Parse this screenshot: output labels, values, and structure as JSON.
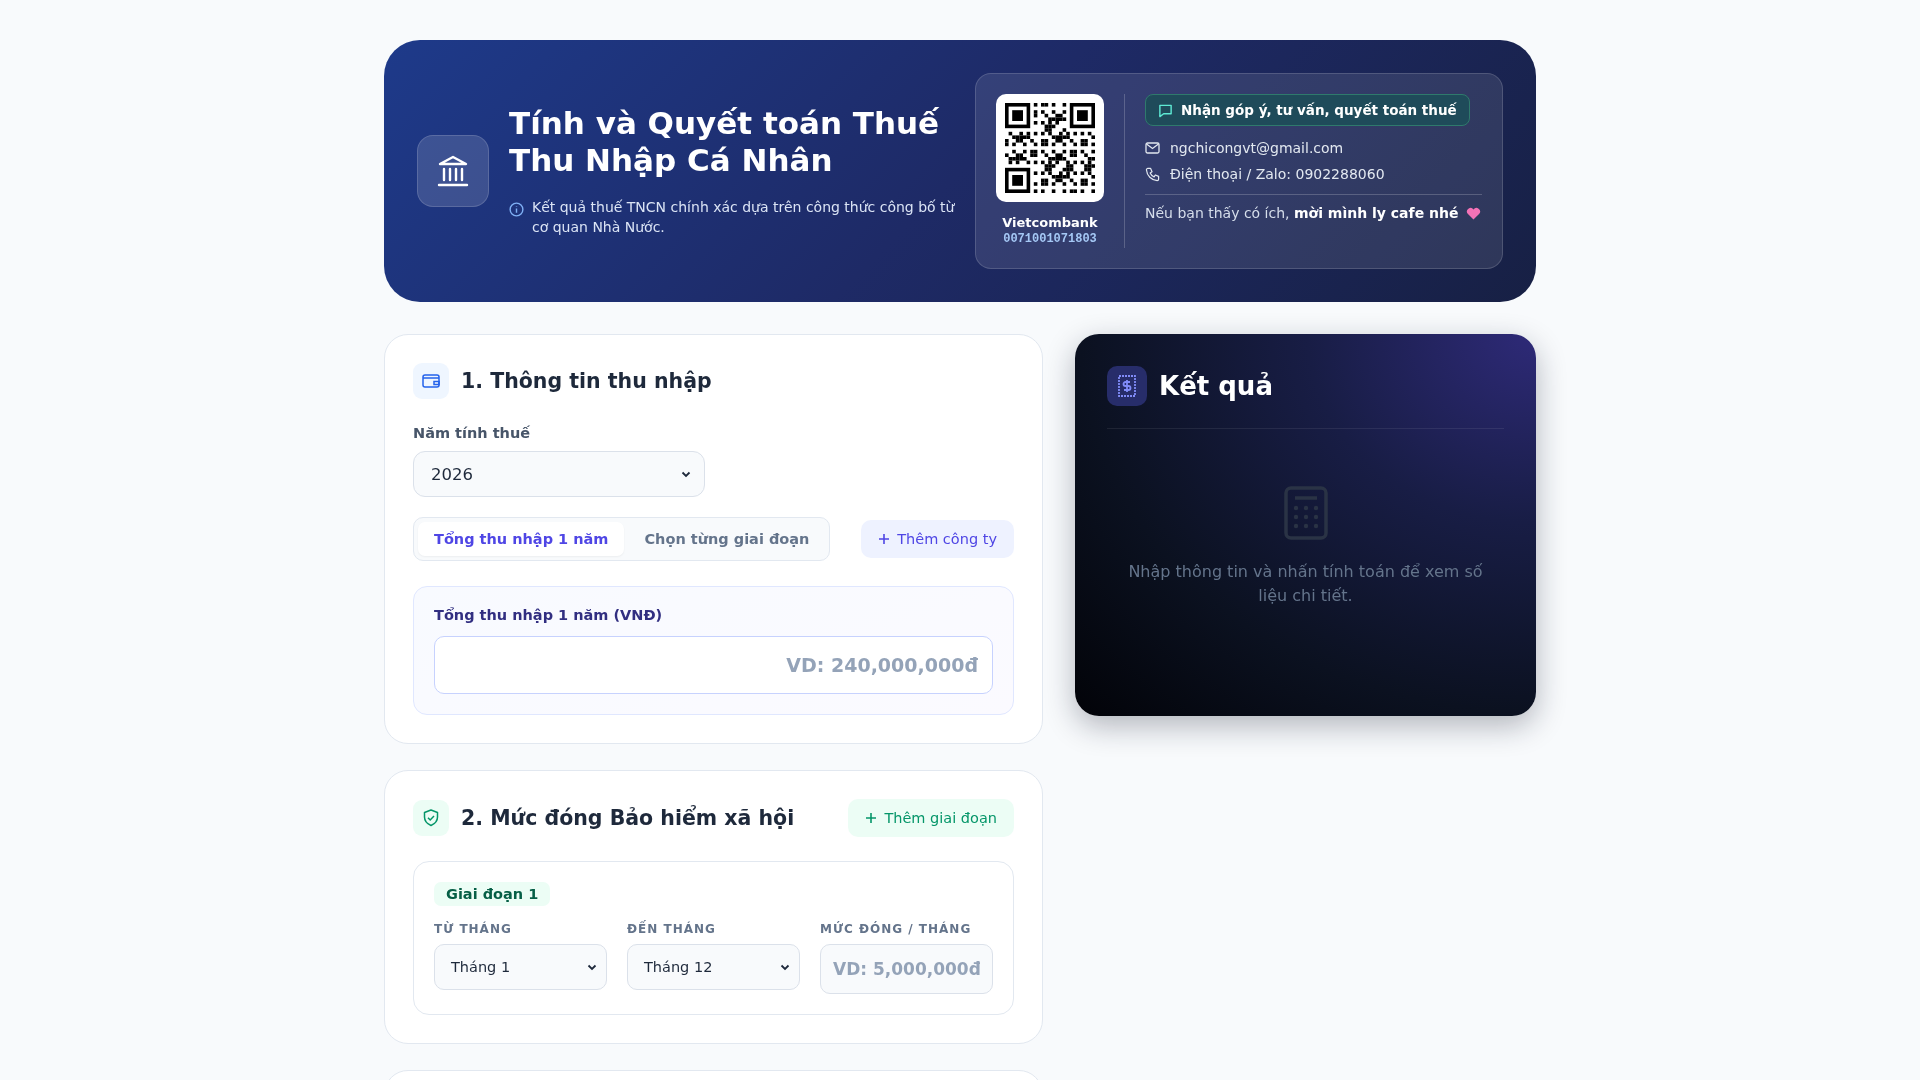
{
  "header": {
    "title_line1": "Tính và Quyết toán Thuế",
    "title_line2": "Thu Nhập Cá Nhân",
    "subtitle": "Kết quả thuế TNCN chính xác dựa trên công thức công bố từ cơ quan Nhà Nước.",
    "donate": {
      "bank": "Vietcombank",
      "account": "0071001071803",
      "feedback_button": "Nhận góp ý, tư vấn, quyết toán thuế",
      "email": "ngchicongvt@gmail.com",
      "phone": "Điện thoại / Zalo: 0902288060",
      "note": "Nếu bạn thấy có ích, **mời mình ly cafe nhé**"
    }
  },
  "income": {
    "title": "1. Thông tin thu nhập",
    "year_label": "Năm tính thuế",
    "year_value": "2026",
    "modes": [
      {
        "label": "Tổng thu nhập 1 năm",
        "selected": true
      },
      {
        "label": "Chọn từng giai đoạn",
        "selected": false
      }
    ],
    "add_company": "Thêm công ty",
    "total_label": "Tổng thu nhập 1 năm (VNĐ)",
    "total_placeholder": "VD: 240,000,000đ"
  },
  "insurance": {
    "title": "2. Mức đóng Bảo hiểm xã hội",
    "add_period": "Thêm giai đoạn",
    "periods": [
      {
        "badge": "Giai đoạn 1",
        "from_label": "TỪ THÁNG",
        "from_value": "Tháng 1",
        "to_label": "ĐẾN THÁNG",
        "to_value": "Tháng 12",
        "amount_label": "MỨC ĐÓNG / THÁNG",
        "amount_placeholder": "VD: 5,000,000đ"
      }
    ]
  },
  "result": {
    "title": "Kết quả",
    "empty_message": "Nhập thông tin và nhấn tính toán để xem số liệu chi tiết."
  }
}
